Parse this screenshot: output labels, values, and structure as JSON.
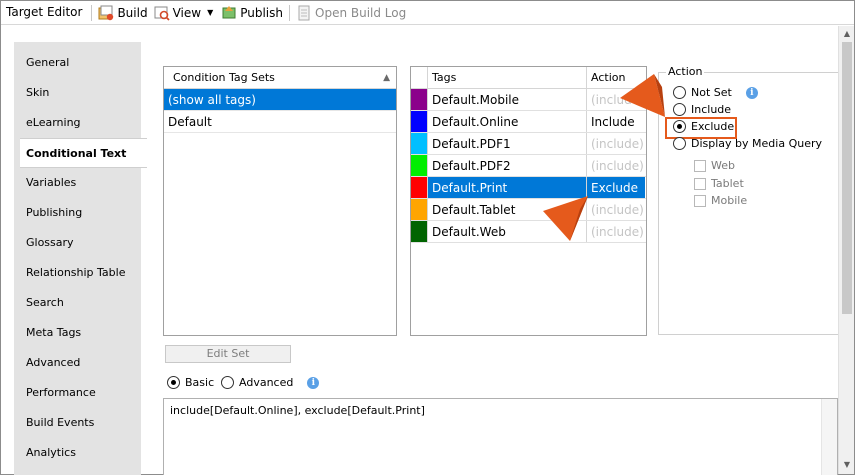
{
  "toolbar": {
    "title": "Target Editor",
    "build_label": "Build",
    "view_label": "View",
    "publish_label": "Publish",
    "open_build_log_label": "Open Build Log"
  },
  "sidebar": {
    "items": [
      {
        "label": "General"
      },
      {
        "label": "Skin"
      },
      {
        "label": "eLearning"
      },
      {
        "label": "Conditional Text"
      },
      {
        "label": "Variables"
      },
      {
        "label": "Publishing"
      },
      {
        "label": "Glossary"
      },
      {
        "label": "Relationship Table"
      },
      {
        "label": "Search"
      },
      {
        "label": "Meta Tags"
      },
      {
        "label": "Advanced"
      },
      {
        "label": "Performance"
      },
      {
        "label": "Build Events"
      },
      {
        "label": "Analytics"
      }
    ],
    "active_index": 3
  },
  "tag_sets": {
    "header": "Condition Tag Sets",
    "rows": [
      "(show all tags)",
      "Default"
    ],
    "selected_index": 0
  },
  "tags_grid": {
    "headers": {
      "tags": "Tags",
      "action": "Action"
    },
    "rows": [
      {
        "color": "#8b008b",
        "name": "Default.Mobile",
        "action": "(include)",
        "muted": true
      },
      {
        "color": "#0000ff",
        "name": "Default.Online",
        "action": "Include",
        "muted": false
      },
      {
        "color": "#00bfff",
        "name": "Default.PDF1",
        "action": "(include)",
        "muted": true
      },
      {
        "color": "#00ee00",
        "name": "Default.PDF2",
        "action": "(include)",
        "muted": true
      },
      {
        "color": "#ff0000",
        "name": "Default.Print",
        "action": "Exclude",
        "muted": false
      },
      {
        "color": "#ffa500",
        "name": "Default.Tablet",
        "action": "(include)",
        "muted": true
      },
      {
        "color": "#006400",
        "name": "Default.Web",
        "action": "(include)",
        "muted": true
      }
    ],
    "selected_index": 4
  },
  "action_group": {
    "title": "Action",
    "options": [
      "Not Set",
      "Include",
      "Exclude",
      "Display by Media Query"
    ],
    "selected": "Exclude",
    "media_queries": [
      "Web",
      "Tablet",
      "Mobile"
    ]
  },
  "edit_set_label": "Edit Set",
  "mode": {
    "basic_label": "Basic",
    "advanced_label": "Advanced",
    "selected": "Basic"
  },
  "expression": "include[Default.Online], exclude[Default.Print]",
  "colors": {
    "accent": "#0078d7",
    "callout": "#e55a1c"
  }
}
